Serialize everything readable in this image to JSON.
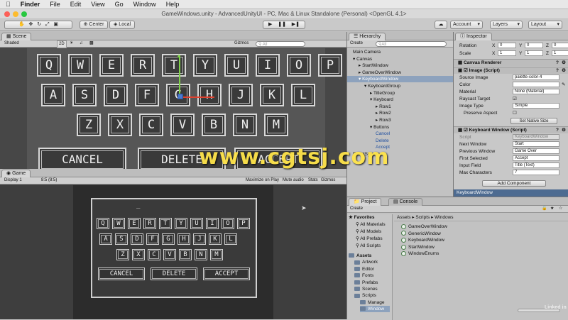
{
  "mac_menu": [
    "Finder",
    "File",
    "Edit",
    "View",
    "Go",
    "Window",
    "Help"
  ],
  "window_title": "GameWindows.unity - AdvancedUnityUI - PC, Mac & Linux Standalone (Personal) <OpenGL 4.1>",
  "toolbar": {
    "center": "Center",
    "local": "Local",
    "account": "Account",
    "layers": "Layers",
    "layout": "Layout"
  },
  "scene": {
    "tab": "Scene",
    "shading": "Shaded",
    "mode_2d": "2D",
    "gizmos": "Gizmos",
    "search_placeholder": "All",
    "rows": [
      [
        "Q",
        "W",
        "E",
        "R",
        "T",
        "Y",
        "U",
        "I",
        "O",
        "P"
      ],
      [
        "A",
        "S",
        "D",
        "F",
        "G",
        "H",
        "J",
        "K",
        "L"
      ],
      [
        "Z",
        "X",
        "C",
        "V",
        "B",
        "N",
        "M"
      ]
    ],
    "buttons": [
      "CANCEL",
      "DELETE",
      "ACCEPT"
    ]
  },
  "game": {
    "tab": "Game",
    "display": "Display 1",
    "aspect": "8:5 (8:5)",
    "maximize": "Maximize on Play",
    "mute": "Mute audio",
    "stats": "Stats",
    "gizmos": "Gizmos",
    "input_text": "_",
    "rows": [
      [
        "Q",
        "W",
        "E",
        "R",
        "T",
        "Y",
        "U",
        "I",
        "O",
        "P"
      ],
      [
        "A",
        "S",
        "D",
        "F",
        "G",
        "H",
        "J",
        "K",
        "L"
      ],
      [
        "Z",
        "X",
        "C",
        "V",
        "B",
        "N",
        "M"
      ]
    ],
    "buttons": [
      "CANCEL",
      "DELETE",
      "ACCEPT"
    ]
  },
  "hierarchy": {
    "tab": "Hierarchy",
    "create": "Create",
    "search": "All",
    "items": [
      "Main Camera",
      "Canvas",
      "StartWindow",
      "GameOverWindow",
      "KeyboardWindow",
      "KeyboardGroup",
      "TitleGroup",
      "Keyboard",
      "Row1",
      "Row2",
      "Row3",
      "Buttons",
      "Cancel",
      "Delete",
      "Accept",
      "EventSystem"
    ]
  },
  "inspector": {
    "tab": "Inspector",
    "rotation_label": "Rotation",
    "rotation": [
      "0",
      "0",
      "0"
    ],
    "scale_label": "Scale",
    "scale": [
      "1",
      "1",
      "1"
    ],
    "canvas_renderer": "Canvas Renderer",
    "image_header": "Image (Script)",
    "source_image_label": "Source Image",
    "source_image": "palette-color-4",
    "color_label": "Color",
    "material_label": "Material",
    "material": "None (Material)",
    "raycast_label": "Raycast Target",
    "image_type_label": "Image Type",
    "image_type": "Simple",
    "preserve_label": "Preserve Aspect",
    "native_size": "Set Native Size",
    "kw_header": "Keyboard Window (Script)",
    "script_label": "Script",
    "script": "KeyboardWindow",
    "next_label": "Next Window",
    "next": "Start",
    "prev_label": "Previous Window",
    "prev": "Game Over",
    "first_label": "First Selected",
    "first": "Accept",
    "input_label": "Input Field",
    "input": "Title (Text)",
    "max_label": "Max Characters",
    "max": "7",
    "add_component": "Add Component",
    "footer": "KeyboardWindow"
  },
  "project": {
    "tab": "Project",
    "console_tab": "Console",
    "create": "Create",
    "favorites": [
      "Favorites",
      "All Materials",
      "All Models",
      "All Prefabs",
      "All Scripts"
    ],
    "assets": [
      "Assets",
      "Artwork",
      "Editor",
      "Fonts",
      "Prefabs",
      "Scenes",
      "Scripts",
      "Manage",
      "Window"
    ],
    "breadcrumb": [
      "Assets",
      "Scripts",
      "Windows"
    ],
    "files": [
      "GameOverWindow",
      "GenericWindow",
      "KeyboardWindow",
      "StartWindow",
      "WindowEnums"
    ]
  },
  "watermark": "www.cgtsj.com",
  "brand": "Linked in"
}
